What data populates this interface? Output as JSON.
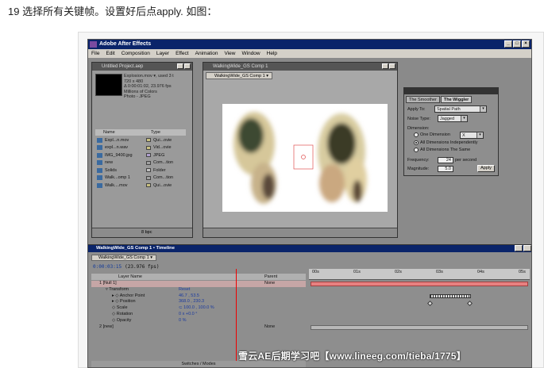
{
  "caption": "19 选择所有关键帧。设置好后点apply. 如图：",
  "app": {
    "title": "Adobe After Effects",
    "menu": [
      "File",
      "Edit",
      "Composition",
      "Layer",
      "Effect",
      "Animation",
      "View",
      "Window",
      "Help"
    ]
  },
  "project": {
    "title": "Untitled Project.aep",
    "info": [
      "Explosion.mov ▾, used 3 t",
      "720 x 480",
      "Δ 0:00:01:02, 23.976 fps",
      "Millions of Colors",
      "Photo - JPEG"
    ],
    "col_name": "Name",
    "col_type": "Type",
    "items": [
      {
        "name": "Expl...n.mov",
        "type": "Qui...ovie",
        "tag": "#c8c080"
      },
      {
        "name": "expl...n.wav",
        "type": "Vid...ovie",
        "tag": "#c8c080"
      },
      {
        "name": "IMG_9400.jpg",
        "type": "JPEG",
        "tag": "#b0a0d0"
      },
      {
        "name": "new",
        "type": "Com...tion",
        "tag": "#a0a0a0"
      },
      {
        "name": "Solids",
        "type": "Folder",
        "tag": "#c0c0c0"
      },
      {
        "name": "Walk...omp 1",
        "type": "Com...tion",
        "tag": "#a0a0a0"
      },
      {
        "name": "Walk....mov",
        "type": "Qui...ovie",
        "tag": "#c8c080"
      }
    ],
    "bpc": "8 bpc"
  },
  "comp": {
    "title": "WalkingWide_GS Comp 1",
    "tab": "WalkingWide_GS Comp 1 ▾"
  },
  "wiggler": {
    "tabs": [
      "The Smoother",
      "The Wiggler"
    ],
    "apply_to_label": "Apply To:",
    "apply_to": "Spatial Path",
    "noise_label": "Noise Type:",
    "noise": "Jagged",
    "dimension_label": "Dimension:",
    "one_dim": "One Dimension",
    "one_dim_value": "X",
    "all_indep": "All Dimensions Independently",
    "all_same": "All Dimensions The Same",
    "freq_label": "Frequency:",
    "freq_value": "24",
    "freq_unit": "per second",
    "mag_label": "Magnitude:",
    "mag_value": "5.0",
    "apply_button": "Apply"
  },
  "timeline": {
    "title": "WalkingWide_GS Comp 1 • Timeline",
    "tab": "WalkingWide_GS Comp 1 ▾",
    "time": "0:00:03:15",
    "fps": "(23.976 fps)",
    "layer_name_header": "Layer Name",
    "parent_header": "Parent",
    "rows": [
      {
        "indent": 0,
        "name": "1  [Null 1]",
        "val": "",
        "parent": "None",
        "sel": true
      },
      {
        "indent": 1,
        "name": "▿ Transform",
        "val": "Reset",
        "parent": "",
        "sel": false
      },
      {
        "indent": 2,
        "name": "▸ ◇ Anchor Point",
        "val": "46.7 , 53.5",
        "parent": "",
        "sel": false
      },
      {
        "indent": 2,
        "name": "▸ ◇ Position",
        "val": "368.0 , 230.3",
        "parent": "",
        "sel": false
      },
      {
        "indent": 2,
        "name": "◇ Scale",
        "val": "⊂ 100.0 , 100.0 %",
        "parent": "",
        "sel": false
      },
      {
        "indent": 2,
        "name": "◇ Rotation",
        "val": "0 x +0.0 °",
        "parent": "",
        "sel": false
      },
      {
        "indent": 2,
        "name": "◇ Opacity",
        "val": "0 %",
        "parent": "",
        "sel": false
      },
      {
        "indent": 0,
        "name": "2  [new]",
        "val": "",
        "parent": "None",
        "sel": false
      }
    ],
    "ruler": [
      "00s",
      "01s",
      "02s",
      "03s",
      "04s",
      "05s"
    ],
    "footer": "Switches / Modes"
  },
  "watermark": "雪云AE后期学习吧【www.lineeg.com/tieba/1775】"
}
